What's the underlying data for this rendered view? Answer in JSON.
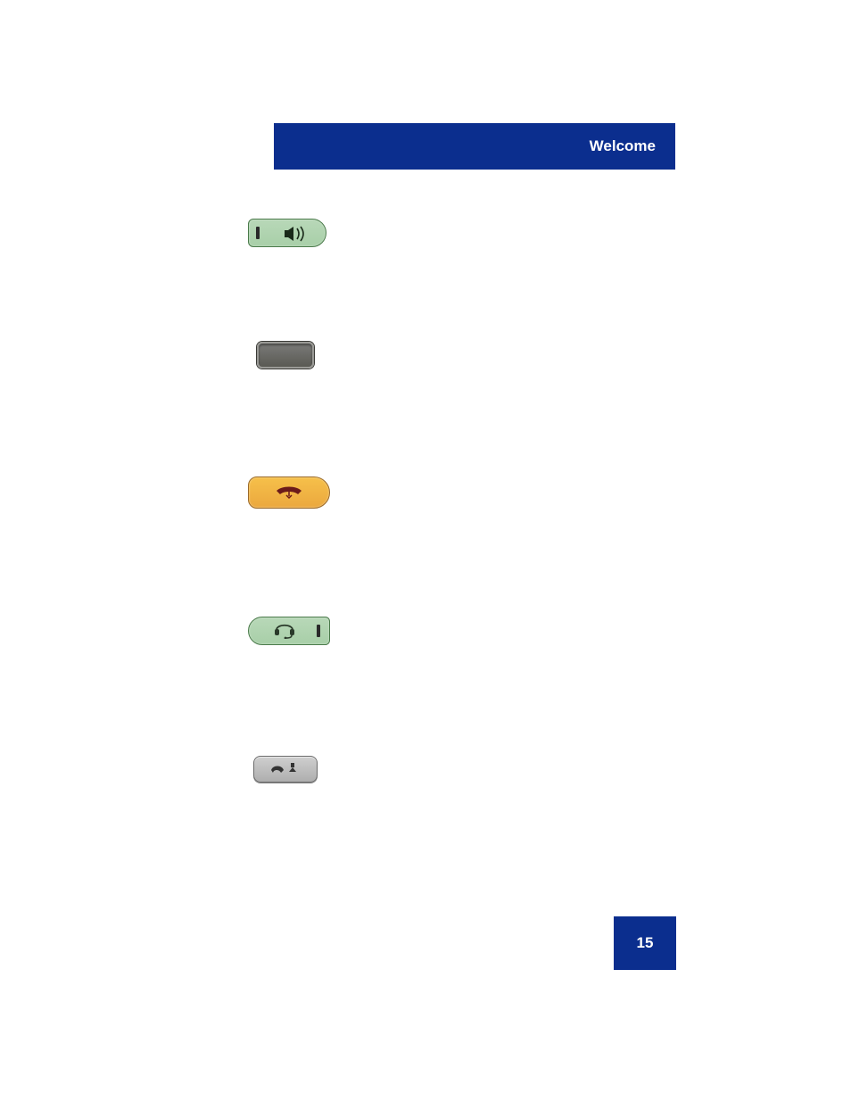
{
  "header": {
    "title": "Welcome"
  },
  "page": {
    "number": "15"
  },
  "keys": {
    "handsfree": {
      "name": "handsfree-key"
    },
    "mute": {
      "name": "mute-key"
    },
    "goodbye": {
      "name": "goodbye-key"
    },
    "headset": {
      "name": "headset-key"
    },
    "hold": {
      "name": "hold-key"
    }
  }
}
